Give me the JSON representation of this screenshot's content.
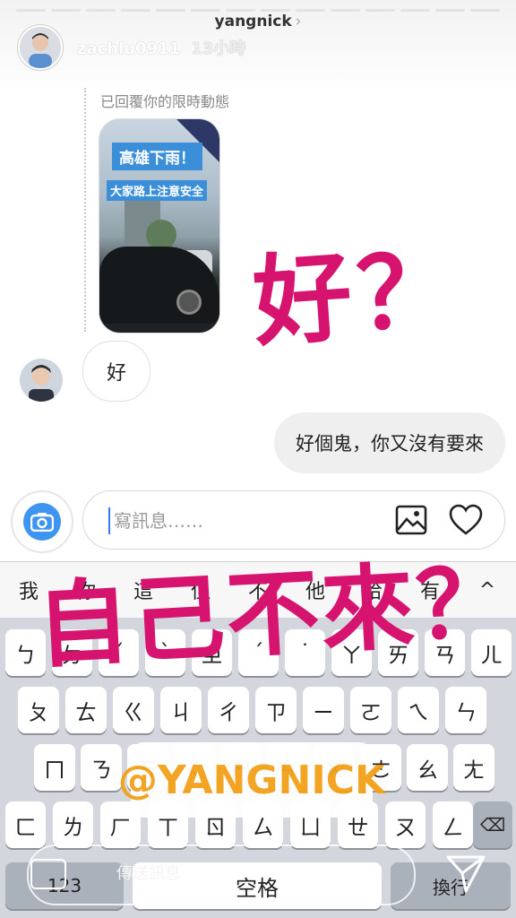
{
  "header": {
    "username": "yangnick",
    "story_author": "zachlu0911",
    "story_time": "13小時"
  },
  "reply": {
    "label": "已回覆你的限時動態",
    "story_title": "高雄下雨！",
    "story_subtitle": "大家路上注意安全"
  },
  "messages": {
    "received": "好",
    "sent": "好個鬼，你又沒有要來"
  },
  "composer": {
    "placeholder": "寫訊息……",
    "value": ""
  },
  "overlay": {
    "text_big": "好？",
    "text_bottom": "自己不來？",
    "mention": "@YANGNICK",
    "send_label": "傳送訊息"
  },
  "keyboard": {
    "candidates": [
      "我",
      "你",
      "這",
      "但",
      "不",
      "他",
      "哈",
      "有",
      "^"
    ],
    "row1": [
      "ㄅ",
      "ㄉ",
      "ˇ",
      "ˋ",
      "ㄓ",
      "ˊ",
      "˙",
      "ㄚ",
      "ㄞ",
      "ㄢ",
      "ㄦ"
    ],
    "row2": [
      "ㄆ",
      "ㄊ",
      "ㄍ",
      "ㄐ",
      "ㄔ",
      "ㄗ",
      "ㄧ",
      "ㄛ",
      "ㄟ",
      "ㄣ"
    ],
    "row3": [
      "ㄇ",
      "ㄋ",
      "ㄎ",
      "ㄑ",
      "ㄕ",
      "ㄘ",
      "ㄨ",
      "ㄜ",
      "ㄠ",
      "ㄤ"
    ],
    "row4": [
      "ㄈ",
      "ㄌ",
      "ㄏ",
      "ㄒ",
      "ㄖ",
      "ㄙ",
      "ㄩ",
      "ㄝ",
      "ㄡ",
      "ㄥ"
    ],
    "numbers_key": "123",
    "space_key": "空格",
    "return_key": "換行",
    "delete_key": "⌫"
  },
  "colors": {
    "overlay_text": "#d6136f",
    "mention": "#f3a11b",
    "camera": "#3d95f0"
  }
}
